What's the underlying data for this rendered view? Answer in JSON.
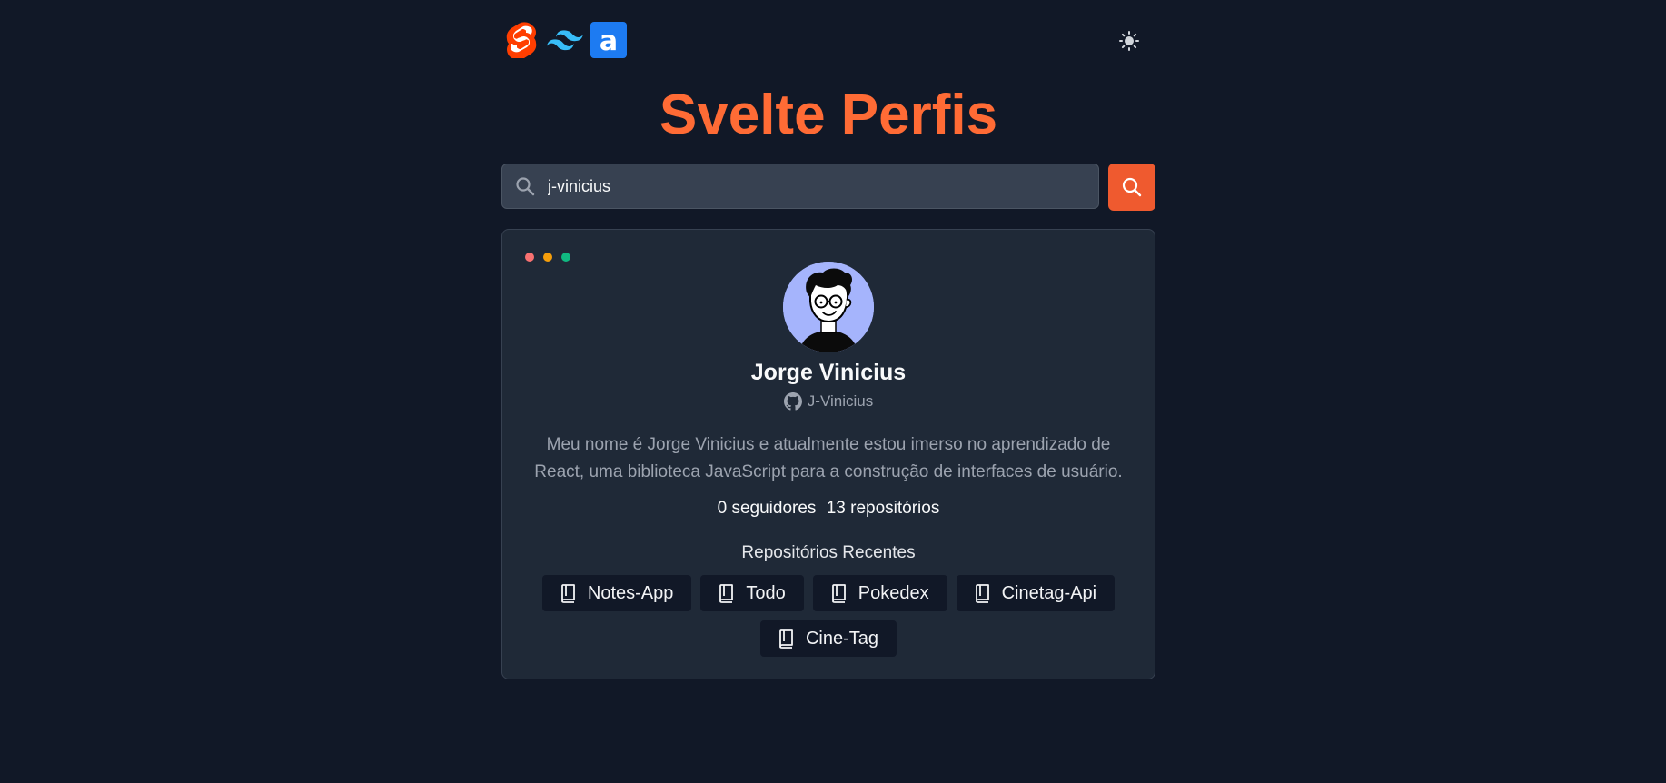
{
  "header": {
    "logos": [
      {
        "icon": "svelte-logo-icon",
        "color": "#ff3e00"
      },
      {
        "icon": "tailwind-logo-icon",
        "color": "#38bdf8"
      },
      {
        "icon": "axios-logo-icon",
        "color": "#1d7bf2"
      }
    ],
    "theme_toggle_icon": "sun-icon"
  },
  "title": "Svelte Perfis",
  "search": {
    "value": "j-vinicius",
    "placeholder": "",
    "icon": "search-icon",
    "button_icon": "search-icon"
  },
  "profile": {
    "window_dots": [
      "#f87171",
      "#f59e0b",
      "#10b981"
    ],
    "name": "Jorge Vinicius",
    "username": "J-Vinicius",
    "bio": "Meu nome é Jorge Vinicius e atualmente estou imerso no aprendizado de React, uma biblioteca JavaScript para a construção de interfaces de usuário.",
    "followers": "0 seguidores",
    "repositories": "13 repositórios",
    "recent_repos_title": "Repositórios Recentes",
    "recent_repos": [
      {
        "label": "Notes-App"
      },
      {
        "label": "Todo"
      },
      {
        "label": "Pokedex"
      },
      {
        "label": "Cinetag-Api"
      },
      {
        "label": "Cine-Tag"
      }
    ]
  },
  "colors": {
    "background": "#111827",
    "card": "#1f2937",
    "accent": "#ff6b35",
    "search_button": "#ef5a2f"
  }
}
